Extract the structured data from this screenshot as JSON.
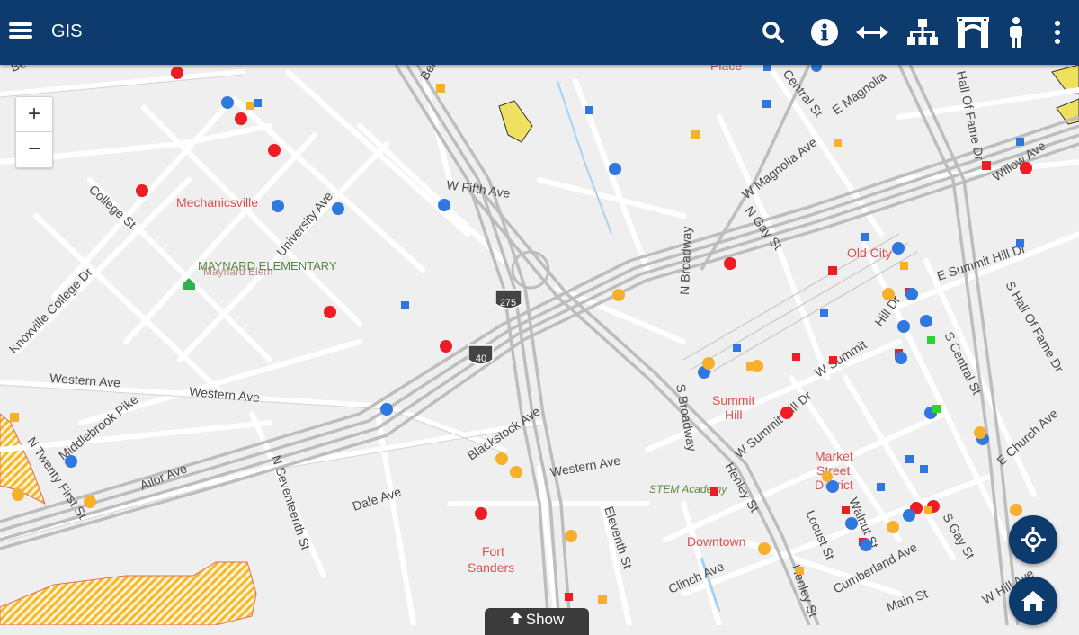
{
  "app": {
    "title": "GIS"
  },
  "header": {
    "icons": [
      "menu-icon",
      "search-icon",
      "info-icon",
      "measure-icon",
      "hierarchy-icon",
      "bridge-icon",
      "person-icon",
      "more-vert-icon"
    ]
  },
  "map": {
    "zoom_in_label": "+",
    "zoom_out_label": "−",
    "show_label": "Show",
    "streets": {
      "be": "Be",
      "bern": "Bern",
      "college_st": "College St",
      "knoxville_college_dr": "Knoxville College Dr",
      "university_ave": "University Ave",
      "w_fifth_ave": "W Fifth Ave",
      "western_ave_1": "Western Ave",
      "western_ave_2": "Western Ave",
      "western_ave_3": "Western Ave",
      "middlebrook_pike": "Middlebrook Pike",
      "n_twenty_first_st": "N Twenty First St",
      "ailor_ave": "Ailor Ave",
      "n_seventeenth_st": "N Seventeenth St",
      "dale_ave": "Dale Ave",
      "blackstock_ave": "Blackstock Ave",
      "eleventh_st": "Eleventh St",
      "n_broadway": "N Broadway",
      "s_broadway": "S Broadway",
      "n_gay_st": "N Gay St",
      "w_magnolia_ave": "W Magnolia Ave",
      "e_magnolia": "E Magnolia",
      "central_st": "Central St",
      "hall_of_fame_dr": "Hall Of Fame Dr",
      "willow_ave": "Willow Ave",
      "e_summit_hill_dr": "E Summit Hill Dr",
      "s_hall_of_fame_dr": "S Hall Of Fame Dr",
      "hill_dr": "Hill Dr",
      "w_summit": "W Summit",
      "s_central_st": "S Central St",
      "w_summit_hill_dr": "W Summit Hill Dr",
      "henley_st": "Henley St",
      "locust_st": "Locust St",
      "walnut_st": "Walnut St",
      "s_gay_st": "S Gay St",
      "cumberland_ave": "Cumberland Ave",
      "main_st": "Main St",
      "w_hill_ave": "W Hill Ave",
      "e_church_ave": "E Church Ave",
      "clinch_ave": "Clinch Ave",
      "henley_st_2": "Henley St",
      "place": "Place"
    },
    "places": {
      "mechanicsville": "Mechanicsville",
      "old_city": "Old City",
      "summit_hill_1": "Summit",
      "summit_hill_2": "Hill",
      "market_1": "Market",
      "market_2": "Street",
      "market_3": "District",
      "fort_sanders_1": "Fort",
      "fort_sanders_2": "Sanders",
      "downtown": "Downtown"
    },
    "schools": {
      "maynard": "MAYNARD ELEMENTARY",
      "maynard_under": "Maynard Elem",
      "stem": "STEM Academy"
    },
    "shields": {
      "i275": "275",
      "i40": "40"
    },
    "colors": {
      "header": "#0d3b6e",
      "point_red": "#ee1c25",
      "point_blue": "#2f78e0",
      "point_orange": "#f7b02c",
      "point_green": "#2dd42d",
      "place_label": "#d9534f",
      "school_label": "#5a8a3a",
      "hatch": "#f5b82a"
    }
  }
}
